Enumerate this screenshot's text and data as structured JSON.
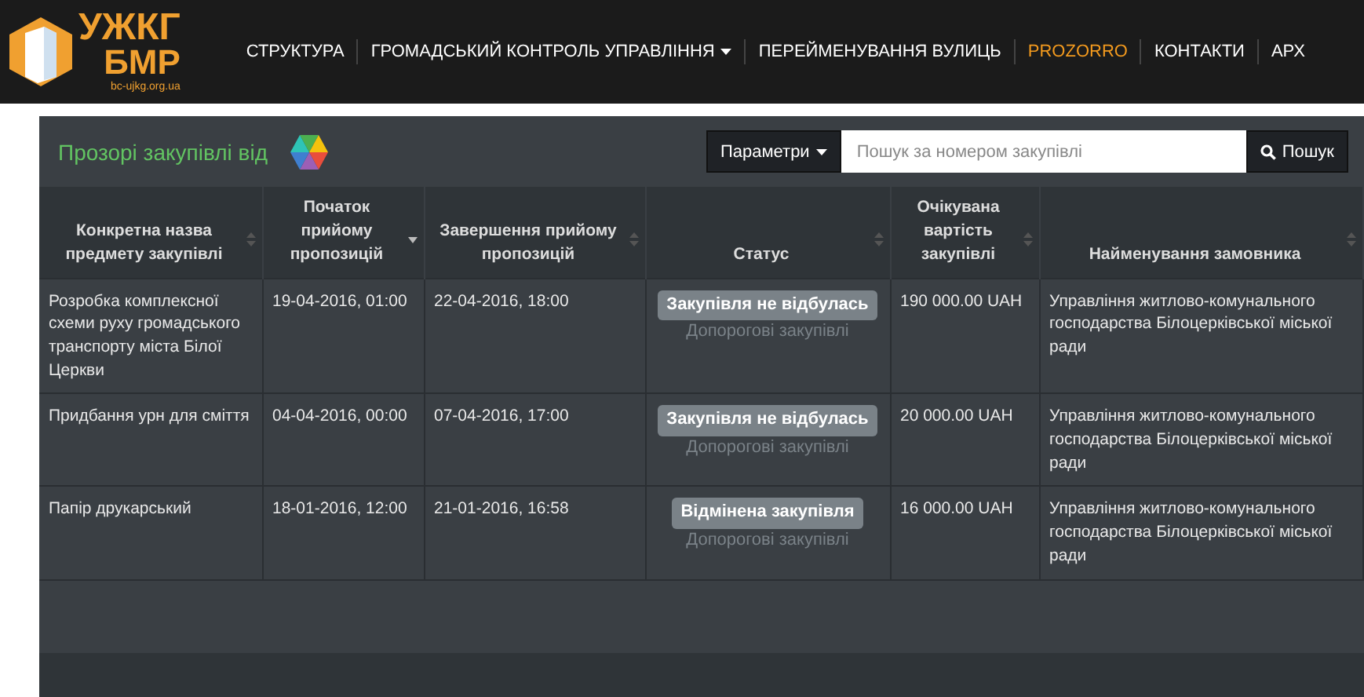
{
  "header": {
    "logo": {
      "line_1": "УЖКГ",
      "line_2": "БМР",
      "url": "bc-ujkg.org.ua"
    },
    "nav": [
      {
        "label": "СТРУКТУРА",
        "selected": false,
        "dropdown": false
      },
      {
        "label": "ГРОМАДСЬКИЙ КОНТРОЛЬ УПРАВЛІННЯ",
        "selected": false,
        "dropdown": true
      },
      {
        "label": "ПЕРЕЙМЕНУВАННЯ ВУЛИЦЬ",
        "selected": false,
        "dropdown": false
      },
      {
        "label": "PROZORRO",
        "selected": true,
        "dropdown": false
      },
      {
        "label": "КОНТАКТИ",
        "selected": false,
        "dropdown": false
      },
      {
        "label": "АРХ",
        "selected": false,
        "dropdown": false
      }
    ]
  },
  "panel": {
    "title": "Прозорі закупівлі від",
    "params_button": "Параметри",
    "search": {
      "placeholder": "Пошук за номером закупівлі"
    },
    "search_button": "Пошук"
  },
  "table": {
    "columns": [
      {
        "label": "Конкретна назва предмету закупівлі",
        "sorted": false
      },
      {
        "label": "Початок прийому пропозицій",
        "sorted": true
      },
      {
        "label": "Завершення прийому пропозицій",
        "sorted": false
      },
      {
        "label": "Статус",
        "sorted": false
      },
      {
        "label": "Очікувана вартість закупівлі",
        "sorted": false
      },
      {
        "label": "Найменування замовника",
        "sorted": false
      }
    ],
    "rows": [
      {
        "name": "Розробка комплексної схеми руху громадського транспорту міста Білої Церкви",
        "start": "19-04-2016, 01:00",
        "end": "22-04-2016, 18:00",
        "status": "Закупівля не відбулась",
        "type": "Допорогові закупівлі",
        "value": "190 000.00 UAH",
        "customer": "Управління житлово-комунального господарства Білоцерківської міської ради"
      },
      {
        "name": "Придбання урн для сміття",
        "start": "04-04-2016, 00:00",
        "end": "07-04-2016, 17:00",
        "status": "Закупівля не відбулась",
        "type": "Допорогові закупівлі",
        "value": "20 000.00 UAH",
        "customer": "Управління житлово-комунального господарства Білоцерківської міської ради"
      },
      {
        "name": "Папір друкарський",
        "start": "18-01-2016, 12:00",
        "end": "21-01-2016, 16:58",
        "status": "Відмінена закупівля",
        "type": "Допорогові закупівлі",
        "value": "16 000.00 UAH",
        "customer": "Управління житлово-комунального господарства Білоцерківської міської ради"
      }
    ]
  }
}
